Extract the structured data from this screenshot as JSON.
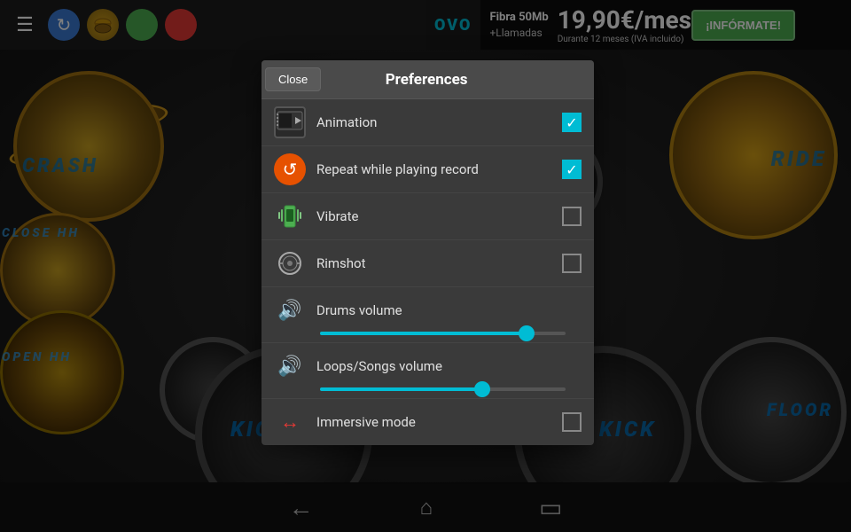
{
  "topBar": {
    "menuIcon": "☰",
    "icons": [
      "reload",
      "gold",
      "green",
      "red"
    ]
  },
  "ad": {
    "brand": "OVO",
    "line1": "Fibra 50Mb",
    "line2": "+Llamadas",
    "price": "19,90€/mes",
    "priceNote": "Durante 12 meses (IVA incluido)",
    "btnLabel": "¡INFÓRMATE!"
  },
  "bottomNav": {
    "back": "←",
    "home": "⌂",
    "recent": "▭"
  },
  "dialog": {
    "closeLabel": "Close",
    "title": "Preferences",
    "items": [
      {
        "id": "animation",
        "label": "Animation",
        "type": "checkbox",
        "checked": true,
        "iconType": "film"
      },
      {
        "id": "repeat",
        "label": "Repeat while playing record",
        "type": "checkbox",
        "checked": true,
        "iconType": "repeat"
      },
      {
        "id": "vibrate",
        "label": "Vibrate",
        "type": "checkbox",
        "checked": false,
        "iconType": "vibrate"
      },
      {
        "id": "rimshot",
        "label": "Rimshot",
        "type": "checkbox",
        "checked": false,
        "iconType": "rimshot"
      }
    ],
    "sliders": [
      {
        "id": "drums-volume",
        "label": "Drums volume",
        "iconType": "volume-blue",
        "fillPercent": 84
      },
      {
        "id": "loops-volume",
        "label": "Loops/Songs volume",
        "iconType": "volume-purple",
        "fillPercent": 66
      }
    ],
    "lastItem": {
      "id": "immersive",
      "label": "Immersive mode",
      "type": "checkbox",
      "checked": false,
      "iconType": "arrows"
    }
  },
  "drumLabels": {
    "crash": "CRASH",
    "ride": "RIDE",
    "floor": "FLOOR",
    "kick1": "KICK",
    "kick2": "KICK",
    "closeHH": "CLOSE HH",
    "openHH": "OPEN HH"
  }
}
